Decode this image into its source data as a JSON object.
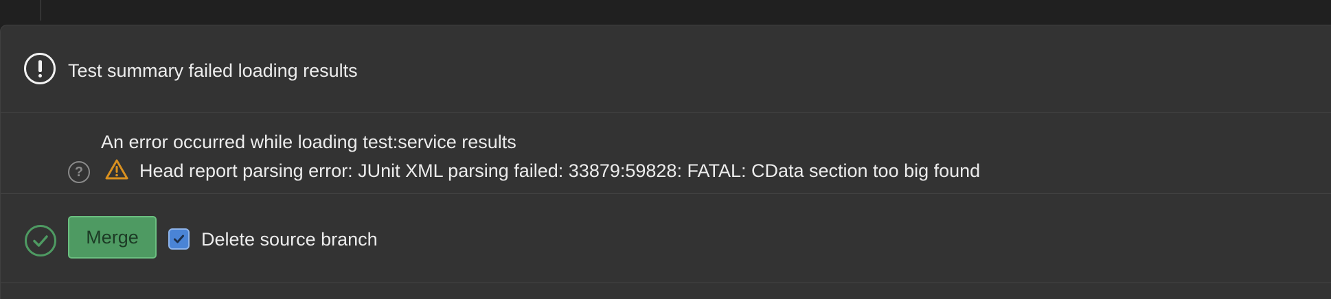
{
  "summary": {
    "icon": "alert-circle-icon",
    "text": "Test summary failed loading results"
  },
  "detail": {
    "help_icon": "question-circle-icon",
    "help_glyph": "?",
    "title": "An error occurred while loading test:service results",
    "warning_icon": "warning-triangle-icon",
    "error_text": "Head report parsing error: JUnit XML parsing failed: 33879:59828: FATAL: CData section too big found"
  },
  "merge": {
    "status_icon": "check-circle-icon",
    "button_label": "Merge",
    "checkbox_checked": true,
    "checkbox_label": "Delete source branch"
  },
  "colors": {
    "success": "#4e9a62",
    "warning": "#d9901f",
    "checkbox": "#4a84d6",
    "muted_icon": "#8a8a8a"
  }
}
